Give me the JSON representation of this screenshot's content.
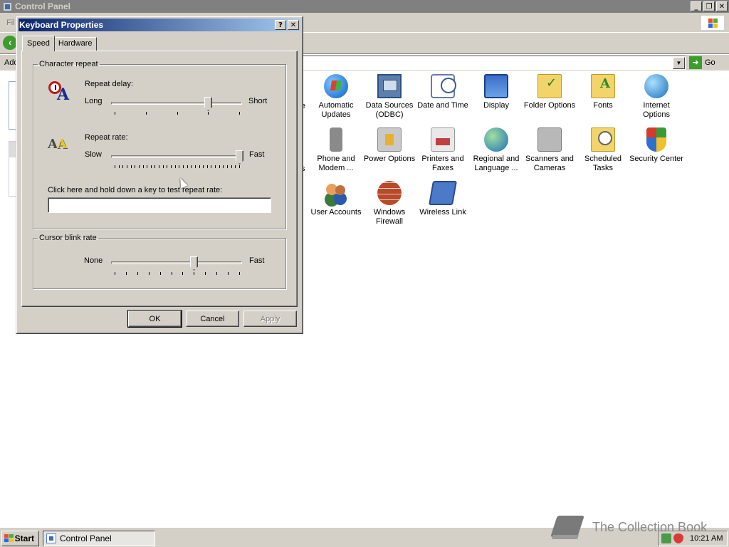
{
  "control_panel": {
    "title": "Control Panel",
    "menu_partial": "Fil",
    "address_partial": "Add",
    "go_label": "Go",
    "partial_labels": [
      "e",
      "s",
      "l"
    ],
    "icons": [
      {
        "label": "Automatic Updates",
        "icon": "windows-update-icon"
      },
      {
        "label": "Data Sources (ODBC)",
        "icon": "odbc-icon"
      },
      {
        "label": "Date and Time",
        "icon": "clock-icon"
      },
      {
        "label": "Display",
        "icon": "monitor-icon"
      },
      {
        "label": "Folder Options",
        "icon": "folder-icon"
      },
      {
        "label": "Fonts",
        "icon": "fonts-folder-icon"
      },
      {
        "label": "Internet Options",
        "icon": "globe-icon"
      },
      {
        "label": "Phone and Modem ...",
        "icon": "phone-icon"
      },
      {
        "label": "Power Options",
        "icon": "power-icon"
      },
      {
        "label": "Printers and Faxes",
        "icon": "printer-icon"
      },
      {
        "label": "Regional and Language ...",
        "icon": "regional-globe-icon"
      },
      {
        "label": "Scanners and Cameras",
        "icon": "scanner-icon"
      },
      {
        "label": "Scheduled Tasks",
        "icon": "scheduled-tasks-icon"
      },
      {
        "label": "Security Center",
        "icon": "shield-icon"
      },
      {
        "label": "User Accounts",
        "icon": "users-icon"
      },
      {
        "label": "Windows Firewall",
        "icon": "firewall-icon"
      },
      {
        "label": "Wireless Link",
        "icon": "wireless-icon"
      }
    ]
  },
  "dialog": {
    "title": "Keyboard Properties",
    "help_glyph": "?",
    "close_glyph": "✕",
    "tabs": [
      "Speed",
      "Hardware"
    ],
    "active_tab": "Speed",
    "character_repeat": {
      "legend": "Character repeat",
      "delay_label": "Repeat delay:",
      "delay_min": "Long",
      "delay_max": "Short",
      "delay_value": 3,
      "delay_max_steps": 4,
      "rate_label": "Repeat rate:",
      "rate_min": "Slow",
      "rate_max": "Fast",
      "rate_value": 31,
      "rate_max_steps": 31,
      "test_label": "Click here and hold down a key to test repeat rate:",
      "test_value": ""
    },
    "cursor_blink": {
      "legend": "Cursor blink rate",
      "min": "None",
      "max": "Fast",
      "value": 7,
      "max_steps": 11
    },
    "buttons": {
      "ok": "OK",
      "cancel": "Cancel",
      "apply": "Apply"
    }
  },
  "taskbar": {
    "start_label": "Start",
    "task_label": "Control Panel",
    "clock": "10:21 AM",
    "watermark": "The Collection Book"
  },
  "colors": {
    "dialog_face": "#d4d0c8",
    "title_active_start": "#0a246a",
    "title_active_end": "#a6caf0",
    "title_inactive": "#808080"
  }
}
